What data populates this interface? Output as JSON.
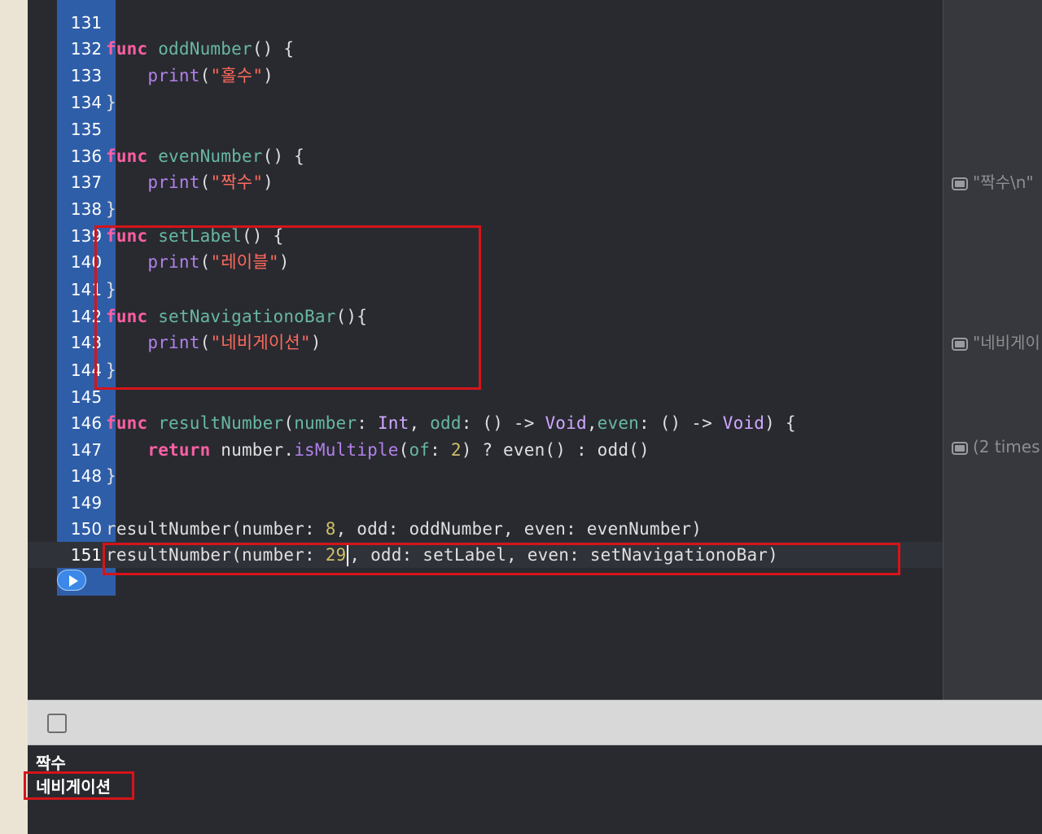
{
  "editor": {
    "lines": [
      {
        "num": "131"
      },
      {
        "num": "132"
      },
      {
        "num": "133"
      },
      {
        "num": "134"
      },
      {
        "num": "135"
      },
      {
        "num": "136"
      },
      {
        "num": "137"
      },
      {
        "num": "138"
      },
      {
        "num": "139"
      },
      {
        "num": "140"
      },
      {
        "num": "141"
      },
      {
        "num": "142"
      },
      {
        "num": "143"
      },
      {
        "num": "144"
      },
      {
        "num": "145"
      },
      {
        "num": "146"
      },
      {
        "num": "147"
      },
      {
        "num": "148"
      },
      {
        "num": "149"
      },
      {
        "num": "150"
      },
      {
        "num": "151"
      }
    ],
    "code": {
      "l132": {
        "kw": "func",
        "name": "oddNumber",
        "rest": "() {"
      },
      "l133": {
        "fn": "print",
        "open": "(",
        "str": "\"홀수\"",
        "close": ")"
      },
      "l134": "}",
      "l136": {
        "kw": "func",
        "name": "evenNumber",
        "rest": "() {"
      },
      "l137": {
        "fn": "print",
        "open": "(",
        "str": "\"짝수\"",
        "close": ")"
      },
      "l138": "}",
      "l139": {
        "kw": "func",
        "name": "setLabel",
        "rest": "() {"
      },
      "l140": {
        "fn": "print",
        "open": "(",
        "str": "\"레이블\"",
        "close": ")"
      },
      "l141": "}",
      "l142": {
        "kw": "func",
        "name": "setNavigationoBar",
        "rest": "(){"
      },
      "l143": {
        "fn": "print",
        "open": "(",
        "str": "\"네비게이션\"",
        "close": ")"
      },
      "l144": "}",
      "l146": {
        "kw": "func",
        "name": "resultNumber",
        "p1": "(",
        "param1": "number",
        "c1": ": ",
        "type1": "Int",
        "sep1": ", ",
        "param2": "odd",
        "c2": ": () -> ",
        "type2": "Void",
        "sep2": ",",
        "param3": "even",
        "c3": ": () -> ",
        "type3": "Void",
        "end": ") {"
      },
      "l147": {
        "kw": "return",
        "a": " number.",
        "fn": "isMultiple",
        "b": "(",
        "param": "of",
        "c": ": ",
        "num": "2",
        "d": ") ? even() : odd()"
      },
      "l148": "}",
      "l150": {
        "a": "resultNumber(number: ",
        "num": "8",
        "b": ", odd: oddNumber, even: evenNumber)"
      },
      "l151": {
        "a": "resultNumber(number: ",
        "num": "29",
        "b": ", odd: setLabel, even: setNavigationoBar)"
      }
    }
  },
  "results_sidebar": {
    "r1": "\"짝수\\n\"",
    "r2": "\"네비게이",
    "r3": "(2 times"
  },
  "console": {
    "lines": [
      "짝수",
      "네비게이션"
    ]
  },
  "colors": {
    "keyword": "#fc5fa3",
    "string": "#fc6a5d",
    "highlight_box": "#d5141a",
    "gutter": "#2f5ea9"
  }
}
